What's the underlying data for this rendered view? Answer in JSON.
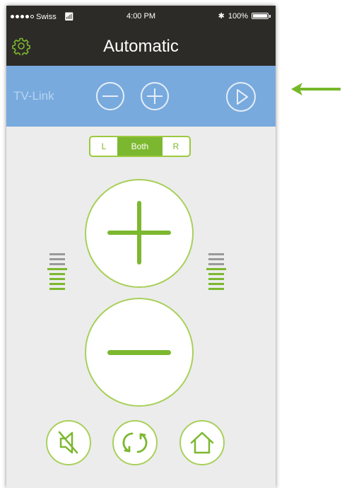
{
  "status_bar": {
    "carrier": "Swiss",
    "time": "4:00 PM",
    "battery": "100%"
  },
  "header": {
    "title": "Automatic"
  },
  "tv_link": {
    "label": "TV-Link"
  },
  "side_selector": {
    "options": [
      "L",
      "Both",
      "R"
    ],
    "selected": "Both"
  },
  "volume_levels": {
    "left_active_fraction": 0.625,
    "right_active_fraction": 0.625
  },
  "colors": {
    "accent": "#7cb82f",
    "header_bg": "#2d2b27",
    "tv_bar": "#78aade",
    "arrow": "#76b82a"
  },
  "icons": {
    "settings": "gear-icon",
    "mute": "mute-icon",
    "program_switch": "cycle-icon",
    "home": "home-icon"
  }
}
